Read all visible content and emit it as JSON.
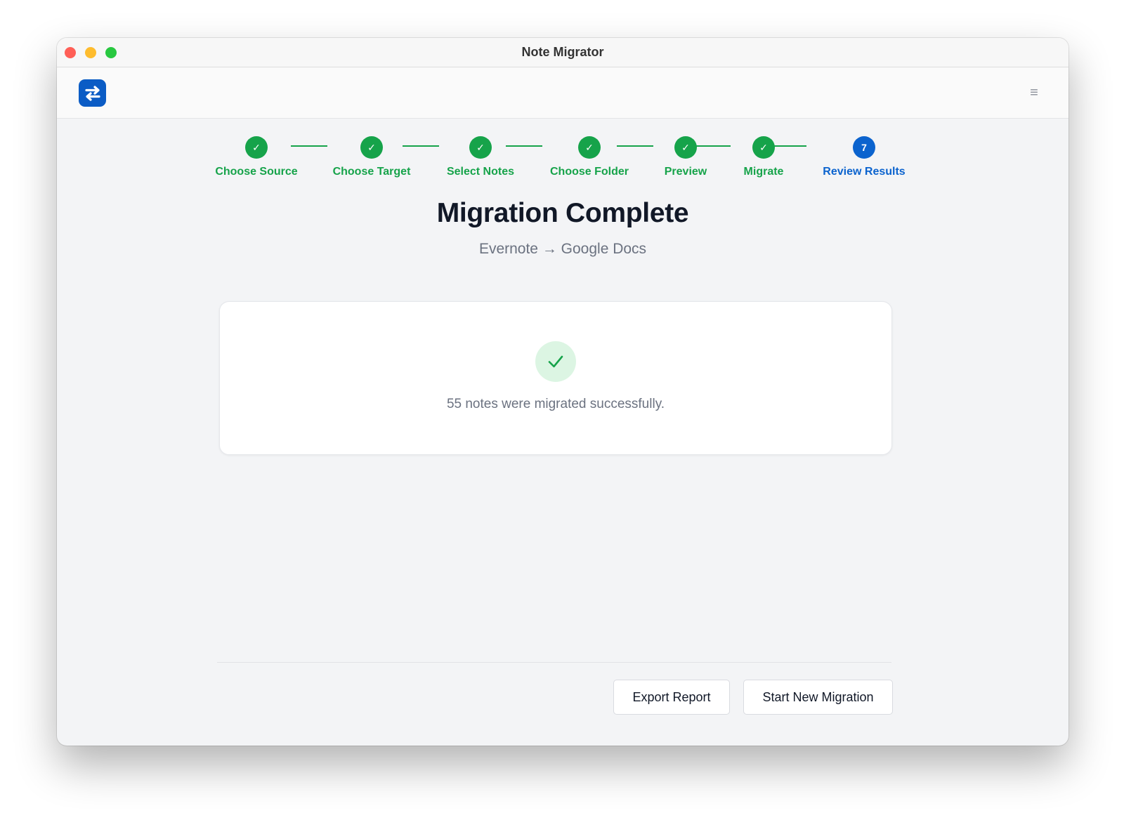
{
  "window": {
    "title": "Note Migrator"
  },
  "header": {
    "logo_icon": "swap-arrows-icon",
    "menu_icon": "hamburger-menu-icon",
    "menu_glyph": "≡"
  },
  "colors": {
    "complete": "#16a34a",
    "active": "#0b63ce",
    "brand": "#0b5cc5"
  },
  "steps": [
    {
      "label": "Choose Source",
      "status": "complete",
      "marker": "✓"
    },
    {
      "label": "Choose Target",
      "status": "complete",
      "marker": "✓"
    },
    {
      "label": "Select Notes",
      "status": "complete",
      "marker": "✓"
    },
    {
      "label": "Choose Folder",
      "status": "complete",
      "marker": "✓"
    },
    {
      "label": "Preview",
      "status": "complete",
      "marker": "✓"
    },
    {
      "label": "Migrate",
      "status": "complete",
      "marker": "✓"
    },
    {
      "label": "Review Results",
      "status": "active",
      "marker": "7"
    }
  ],
  "main": {
    "title": "Migration Complete",
    "subtitle": "Evernote → Google Docs",
    "result_icon": "check-circle-icon",
    "result_message": "55 notes were migrated successfully."
  },
  "footer": {
    "export_label": "Export Report",
    "new_migration_label": "Start New Migration"
  }
}
